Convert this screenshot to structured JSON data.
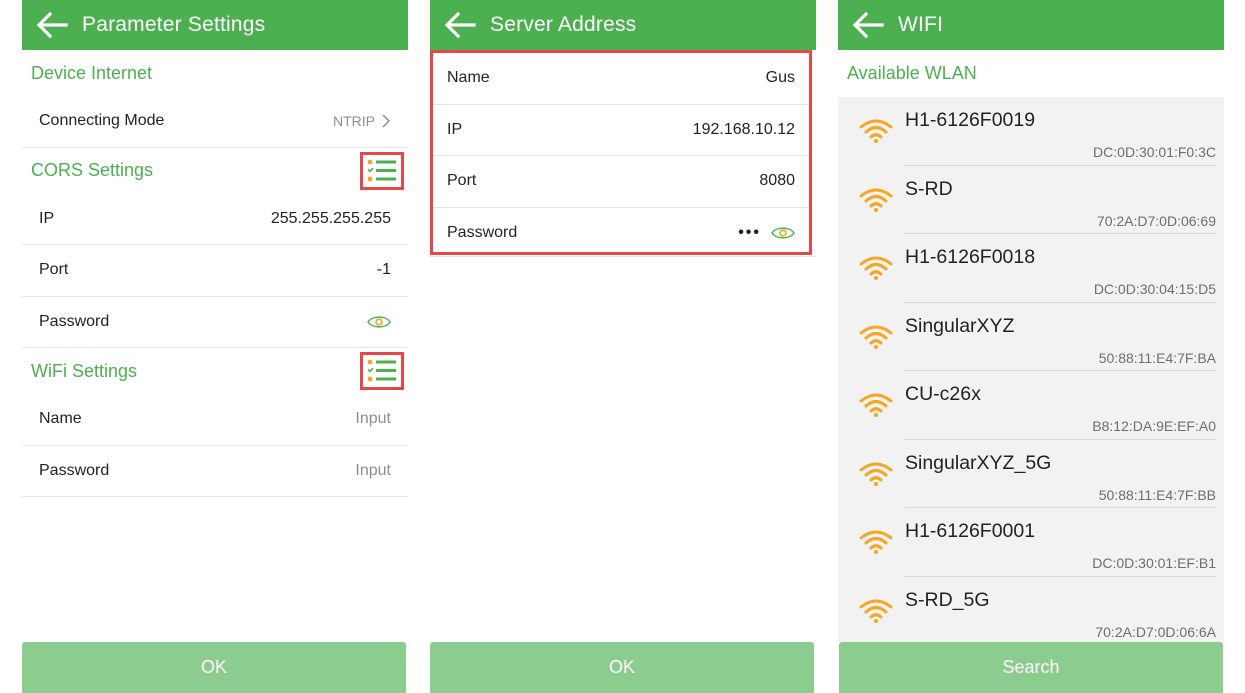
{
  "parameter_settings": {
    "title": "Parameter Settings",
    "device_internet": {
      "header": "Device Internet",
      "connecting_mode_label": "Connecting Mode",
      "connecting_mode_value": "NTRIP"
    },
    "cors_settings": {
      "header": "CORS Settings",
      "ip_label": "IP",
      "ip_value": "255.255.255.255",
      "port_label": "Port",
      "port_value": "-1",
      "password_label": "Password"
    },
    "wifi_settings": {
      "header": "WiFi Settings",
      "name_label": "Name",
      "name_placeholder": "Input",
      "password_label": "Password",
      "password_placeholder": "Input"
    },
    "ok_label": "OK"
  },
  "server_address": {
    "title": "Server Address",
    "name_label": "Name",
    "name_value": "Gus",
    "ip_label": "IP",
    "ip_value": "192.168.10.12",
    "port_label": "Port",
    "port_value": "8080",
    "password_label": "Password",
    "password_mask": "•••",
    "ok_label": "OK"
  },
  "wifi": {
    "title": "WIFI",
    "available_header": "Available WLAN",
    "networks": [
      {
        "ssid": "H1-6126F0019",
        "mac": "DC:0D:30:01:F0:3C"
      },
      {
        "ssid": "S-RD",
        "mac": "70:2A:D7:0D:06:69"
      },
      {
        "ssid": "H1-6126F0018",
        "mac": "DC:0D:30:04:15:D5"
      },
      {
        "ssid": "SingularXYZ",
        "mac": "50:88:11:E4:7F:BA"
      },
      {
        "ssid": "CU-c26x",
        "mac": "B8:12:DA:9E:EF:A0"
      },
      {
        "ssid": "SingularXYZ_5G",
        "mac": "50:88:11:E4:7F:BB"
      },
      {
        "ssid": "H1-6126F0001",
        "mac": "DC:0D:30:01:EF:B1"
      },
      {
        "ssid": "S-RD_5G",
        "mac": "70:2A:D7:0D:06:6A"
      }
    ],
    "search_label": "Search"
  },
  "colors": {
    "primary_green": "#4caf50",
    "button_green": "#8ccc8f",
    "highlight_red": "#e8474a",
    "wifi_orange": "#f5a623"
  },
  "icons": {
    "back": "arrow-left-icon",
    "list": "checklist-icon",
    "eye": "eye-icon",
    "chevron": "chevron-right-icon",
    "wifi": "wifi-signal-icon"
  }
}
